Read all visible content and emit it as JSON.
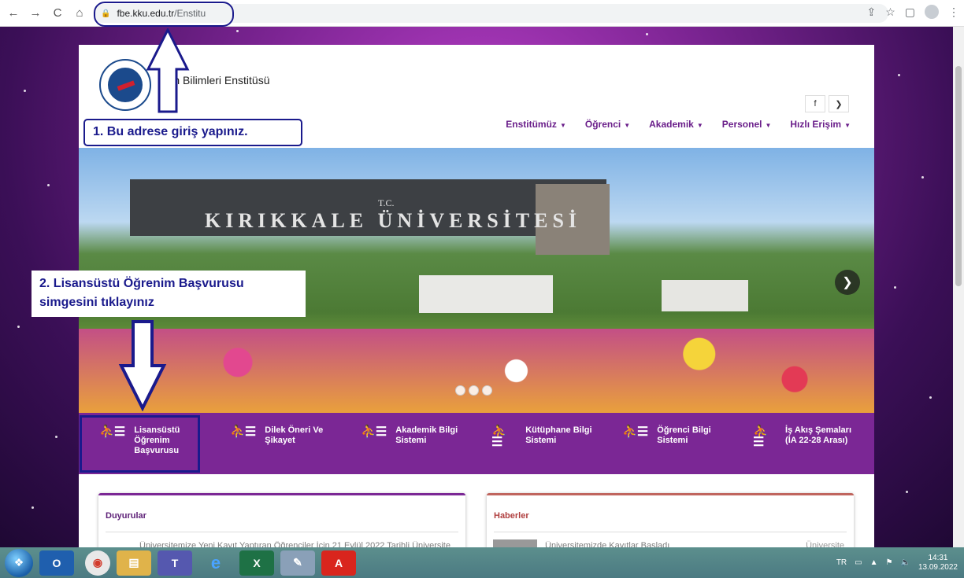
{
  "browser": {
    "url_host": "fbe.kku.edu.tr",
    "url_path": "/Enstitu",
    "nav": {
      "back": "←",
      "forward": "→",
      "reload": "C",
      "home": "⌂"
    },
    "actions": {
      "share": "⇪",
      "bookmark": "☆",
      "sidepanel": "▢",
      "menu": "⋮"
    }
  },
  "site": {
    "title": "Fen Bilimleri Enstitüsü",
    "social": {
      "facebook": "f",
      "twitter": "❯"
    },
    "menu": [
      {
        "label": "Enstitümüz"
      },
      {
        "label": "Öğrenci"
      },
      {
        "label": "Akademik"
      },
      {
        "label": "Personel"
      },
      {
        "label": "Hızlı Erişim"
      }
    ],
    "hero": {
      "sign_tc": "T.C.",
      "sign_text": "KIRIKKALE ÜNİVERSİTESİ",
      "next": "❯"
    },
    "quick_links": [
      {
        "label": "Lisansüstü Öğrenim Başvurusu"
      },
      {
        "label": "Dilek Öneri Ve Şikayet"
      },
      {
        "label": "Akademik Bilgi Sistemi"
      },
      {
        "label": "Kütüphane Bilgi Sistemi"
      },
      {
        "label": "Öğrenci Bilgi Sistemi"
      },
      {
        "label": "İş Akış Şemaları (İA 22-28 Arası)"
      }
    ],
    "announcements": {
      "title": "Duyurular",
      "item": "Üniversitemize Yeni Kayıt Yaptıran Öğrenciler İçin 21 Eylül 2022 Tarihli Üniversite"
    },
    "news": {
      "title": "Haberler",
      "item": "Üniversitemizde Kayıtlar Başladı",
      "category": "Üniversite"
    }
  },
  "annotations": {
    "step1": "1. Bu adrese giriş yapınız.",
    "step2_line1": "2. Lisansüstü Öğrenim Başvurusu",
    "step2_line2": "simgesini tıklayınız"
  },
  "taskbar": {
    "lang": "TR",
    "time": "14:31",
    "date": "13.09.2022"
  }
}
